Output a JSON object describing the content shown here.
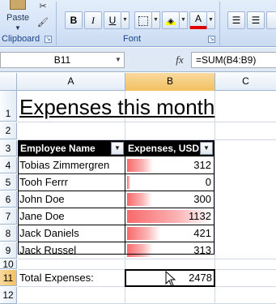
{
  "ribbon": {
    "clipboard": {
      "paste_label": "Paste",
      "group_label": "Clipboard"
    },
    "font": {
      "group_label": "Font",
      "bold": "B",
      "italic": "I",
      "underline": "U",
      "font_color_glyph": "A"
    },
    "alignment": {
      "group_label": ""
    }
  },
  "formula_bar": {
    "name_box": "B11",
    "fx_label": "fx",
    "formula": "=SUM(B4:B9)"
  },
  "columns": [
    "A",
    "B",
    "C"
  ],
  "rows": [
    "1",
    "2",
    "3",
    "4",
    "5",
    "6",
    "7",
    "8",
    "9",
    "10",
    "11",
    "12"
  ],
  "sheet": {
    "title": "Expenses this month",
    "table_headers": {
      "name": "Employee Name",
      "expenses": "Expenses, USD"
    },
    "table_rows": [
      {
        "name": "Tobias Zimmergren",
        "value": "312",
        "amount": 312
      },
      {
        "name": "Tooh Ferrr",
        "value": "0",
        "amount": 0
      },
      {
        "name": "John Doe",
        "value": "300",
        "amount": 300
      },
      {
        "name": "Jane Doe",
        "value": "1132",
        "amount": 1132
      },
      {
        "name": "Jack Daniels",
        "value": "421",
        "amount": 421
      },
      {
        "name": "Jack Russel",
        "value": "313",
        "amount": 313
      }
    ],
    "total_label": "Total Expenses:",
    "total_value": "2478"
  },
  "colors": {
    "databar": "#f8696b",
    "selected_header": "#f1c15f",
    "ribbon_label": "#15428b"
  }
}
